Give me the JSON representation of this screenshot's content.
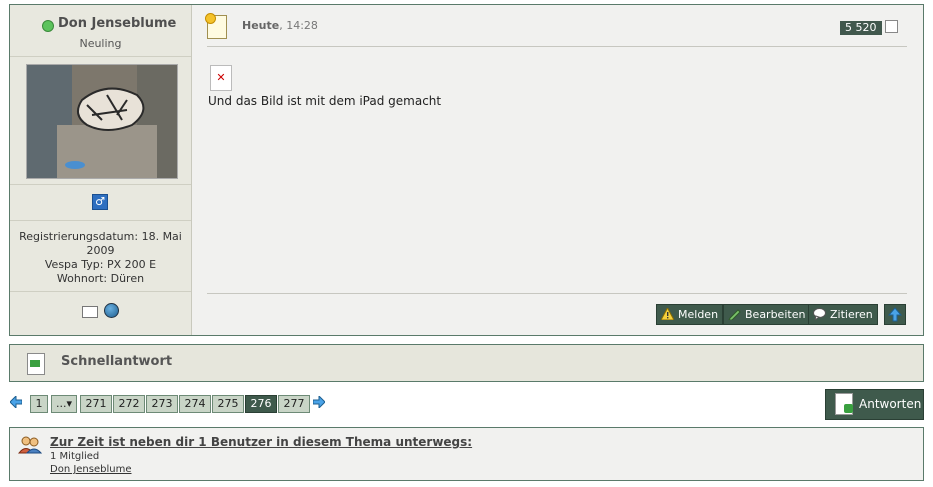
{
  "post": {
    "author": {
      "name": "Don Jenseblume",
      "rank": "Neuling",
      "gender_symbol": "♂",
      "registration_line1": "Registrierungsdatum: 18. Mai",
      "registration_line2": "2009",
      "vespa_type": "Vespa Typ: PX 200 E",
      "residence": "Wohnort: Düren"
    },
    "date_day": "Heute",
    "date_time": ", 14:28",
    "post_count": "5 520",
    "broken_image_glyph": "✕",
    "message": "Und das Bild ist mit dem iPad gemacht",
    "buttons": {
      "report": "Melden",
      "edit": "Bearbeiten",
      "quote": "Zitieren"
    }
  },
  "quick_reply": {
    "title": "Schnellantwort"
  },
  "pagination": {
    "pages": [
      "1",
      "...▾",
      "271",
      "272",
      "273",
      "274",
      "275",
      "276",
      "277"
    ],
    "active_page": "276"
  },
  "reply_button": {
    "label": "Antworten"
  },
  "online": {
    "title": "Zur Zeit ist neben dir 1 Benutzer in diesem Thema unterwegs:",
    "count": "1 Mitglied",
    "user": "Don Jenseblume"
  },
  "colors": {
    "accent": "#3f5a4c",
    "border": "#5a7a6a",
    "online": "#5cc35c"
  }
}
